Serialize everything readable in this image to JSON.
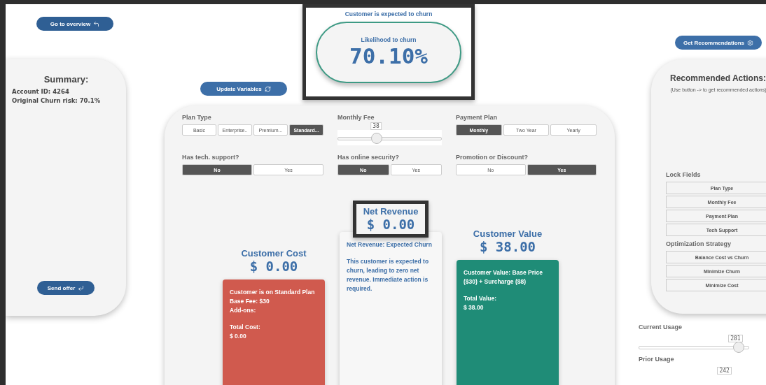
{
  "nav_button": {
    "label": "Go to overview"
  },
  "summary": {
    "title": "Summary:",
    "lines": [
      "Account ID: 4264",
      "Original Churn risk: 70.1%"
    ],
    "send_button": "Send offer"
  },
  "churn": {
    "caption": "Customer is expected to churn",
    "label": "Likelihood to churn",
    "value": "70.10%"
  },
  "update_button": "Update Variables",
  "variables": [
    {
      "kind": "segmented",
      "label": "Plan Type",
      "options": [
        {
          "label": "Basic",
          "selected": false
        },
        {
          "label": "Enterprise..",
          "selected": false
        },
        {
          "label": "Premium...",
          "selected": false
        },
        {
          "label": "Standard...",
          "selected": true
        }
      ]
    },
    {
      "kind": "slider",
      "label": "Monthly Fee",
      "value": "38",
      "level": 0.37
    },
    {
      "kind": "segmented",
      "label": "Payment Plan",
      "options": [
        {
          "label": "Monthly",
          "selected": true
        },
        {
          "label": "Two Year",
          "selected": false
        },
        {
          "label": "Yearly",
          "selected": false
        }
      ]
    },
    {
      "kind": "segmented",
      "label": "Has tech. support?",
      "options": [
        {
          "label": "No",
          "selected": true
        },
        {
          "label": "Yes",
          "selected": false
        }
      ]
    },
    {
      "kind": "segmented",
      "label": "Has online security?",
      "options": [
        {
          "label": "No",
          "selected": true
        },
        {
          "label": "Yes",
          "selected": false
        }
      ]
    },
    {
      "kind": "segmented",
      "label": "Promotion or Discount?",
      "options": [
        {
          "label": "No",
          "selected": false
        },
        {
          "label": "Yes",
          "selected": true
        }
      ]
    }
  ],
  "results": [
    {
      "kind": "cost",
      "title": "Customer Cost",
      "amount": "$ 0.00",
      "blocks": [
        [
          "Customer is on Standard Plan",
          "Base Fee: $30",
          "Add-ons:"
        ],
        [
          "Total Cost:",
          "$ 0.00"
        ]
      ]
    },
    {
      "kind": "net",
      "title": "Net Revenue",
      "amount": "$ 0.00",
      "blocks": [
        [
          "Net Revenue: Expected Churn"
        ],
        [
          "This customer is expected to churn, leading to zero net revenue. Immediate action is required."
        ]
      ]
    },
    {
      "kind": "value",
      "title": "Customer Value",
      "amount": "$ 38.00",
      "blocks": [
        [
          "Customer Value: Base Price ($30) + Surcharge ($8)"
        ],
        [
          "Total Value:",
          "$ 38.00"
        ]
      ]
    }
  ],
  "recommendations": {
    "button": "Get Recommendations",
    "title": "Recommended Actions:",
    "hint": "(Use button -> to get recommended actions)",
    "lock_title": "Lock Fields",
    "lock_fields": [
      "Plan Type",
      "Monthly Fee",
      "Payment Plan",
      "Tech Support"
    ],
    "strategy_title": "Optimization Strategy",
    "strategies": [
      "Balance Cost vs Churn",
      "Minimize Churn",
      "Minimize Cost"
    ]
  },
  "usage": [
    {
      "label": "Current Usage",
      "value": "281",
      "level": 0.9
    },
    {
      "label": "Prior Usage",
      "value": "242"
    }
  ]
}
